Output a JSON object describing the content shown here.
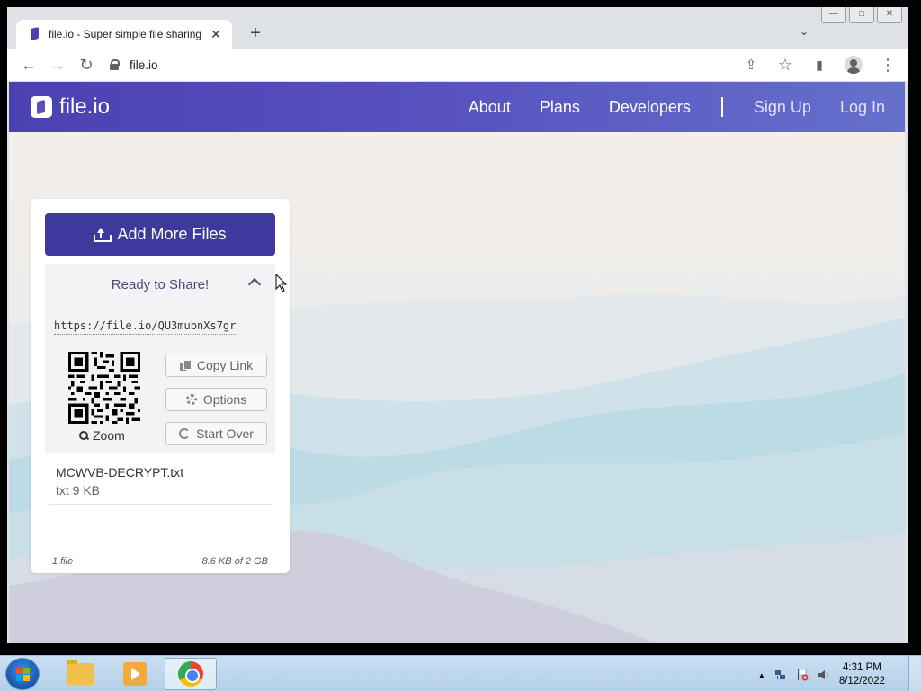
{
  "browser": {
    "tab_title": "file.io - Super simple file sharing",
    "tab_close": "✕",
    "new_tab": "+",
    "tab_search": "⌄",
    "url": "file.io",
    "back": "←",
    "forward": "→",
    "reload": "↻",
    "share": "⇪",
    "star": "☆",
    "sidepanel": "▮",
    "menu": "⋮",
    "win_min": "—",
    "win_max": "□",
    "win_close": "✕"
  },
  "site": {
    "logo_text": "file.io",
    "nav": {
      "about": "About",
      "plans": "Plans",
      "developers": "Developers",
      "signup": "Sign Up",
      "login": "Log In"
    }
  },
  "card": {
    "add_files_label": "Add More Files",
    "share_title": "Ready to Share!",
    "share_link": "https://file.io/QU3mubnXs7gr",
    "zoom_label": "Zoom",
    "copy_link_label": "Copy Link",
    "options_label": "Options",
    "start_over_label": "Start Over",
    "file_name": "MCWVB-DECRYPT.txt",
    "file_meta": "txt 9 KB",
    "footer_count": "1 file",
    "footer_usage": "8.6 KB of 2 GB"
  },
  "taskbar": {
    "clock_time": "4:31 PM",
    "clock_date": "8/12/2022",
    "tray_arrow": "▲"
  },
  "colors": {
    "header_start": "#4b41b2",
    "header_end": "#6570cc",
    "primary_button": "#3e3a9d",
    "share_panel": "#f3f3f5"
  }
}
